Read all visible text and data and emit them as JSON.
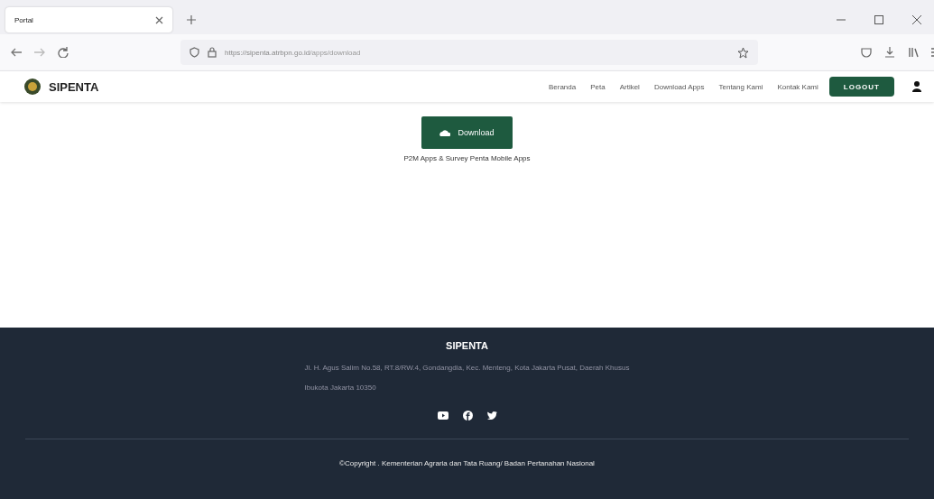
{
  "browser": {
    "tab_title": "Portal",
    "url_host": "https://sipenta.atrbpn.go.id",
    "url_path": "/apps/download"
  },
  "site": {
    "logo_text": "SIPENTA",
    "nav": [
      {
        "label": "Beranda"
      },
      {
        "label": "Peta"
      },
      {
        "label": "Artikel"
      },
      {
        "label": "Download Apps"
      },
      {
        "label": "Tentang Kami"
      },
      {
        "label": "Kontak Kami"
      }
    ],
    "logout_button": "LOGOUT"
  },
  "content": {
    "download_button": "Download",
    "caption": "P2M Apps  & Survey Penta Mobile Apps"
  },
  "footer": {
    "title": "SIPENTA",
    "address": "Jl. H. Agus Salim No.58, RT.8/RW.4, Gondangdia, Kec. Menteng, Kota Jakarta Pusat, Daerah Khusus Ibukota Jakarta 10350",
    "copyright": "©Copyright . Kementerian Agraria dan Tata Ruang/ Badan Pertanahan Nasional"
  }
}
